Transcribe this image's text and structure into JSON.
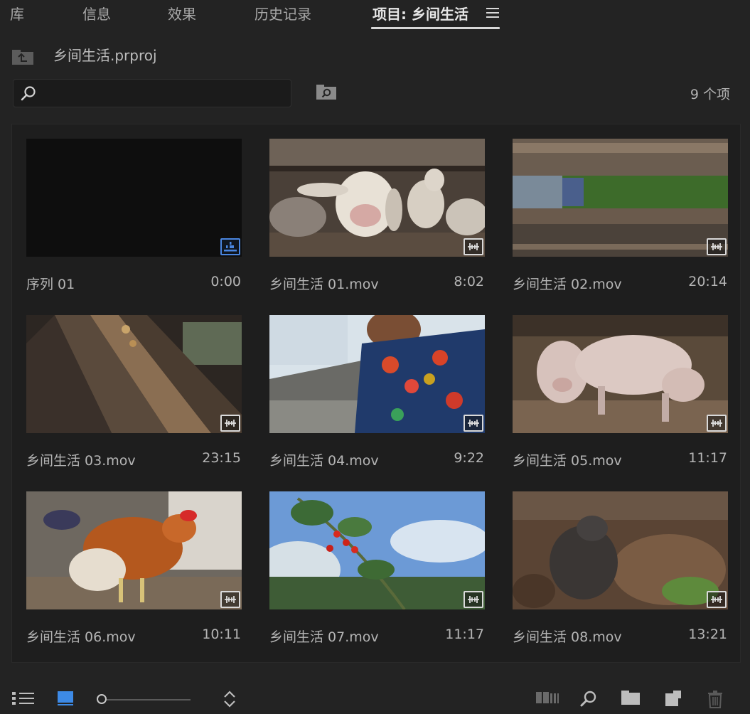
{
  "tabs": [
    {
      "label": "库"
    },
    {
      "label": "信息"
    },
    {
      "label": "效果"
    },
    {
      "label": "历史记录"
    },
    {
      "label": "项目: 乡间生活"
    }
  ],
  "project": {
    "file_name": "乡间生活.prproj",
    "item_count": "9 个项"
  },
  "search": {
    "value": "",
    "placeholder": ""
  },
  "clips": [
    {
      "name": "序列 01",
      "duration": "0:00",
      "kind": "sequence"
    },
    {
      "name": "乡间生活 01.mov",
      "duration": "8:02",
      "kind": "video"
    },
    {
      "name": "乡间生活 02.mov",
      "duration": "20:14",
      "kind": "video"
    },
    {
      "name": "乡间生活 03.mov",
      "duration": "23:15",
      "kind": "video"
    },
    {
      "name": "乡间生活 04.mov",
      "duration": "9:22",
      "kind": "video"
    },
    {
      "name": "乡间生活 05.mov",
      "duration": "11:17",
      "kind": "video"
    },
    {
      "name": "乡间生活 06.mov",
      "duration": "10:11",
      "kind": "video"
    },
    {
      "name": "乡间生活 07.mov",
      "duration": "11:17",
      "kind": "video"
    },
    {
      "name": "乡间生活 08.mov",
      "duration": "13:21",
      "kind": "video"
    }
  ],
  "footer": {
    "list_view": "list-view-icon",
    "icon_view": "icon-view-icon",
    "zoom_level": 0.0,
    "sort": "sort-icon",
    "automate": "automate-to-sequence-icon",
    "find": "find-icon",
    "new_bin": "new-bin-icon",
    "new_item": "new-item-icon",
    "clear": "trash-icon"
  },
  "colors": {
    "background": "#232323",
    "panel": "#1e1e1e",
    "text": "#b5b5b5",
    "accent": "#4a86e0"
  }
}
